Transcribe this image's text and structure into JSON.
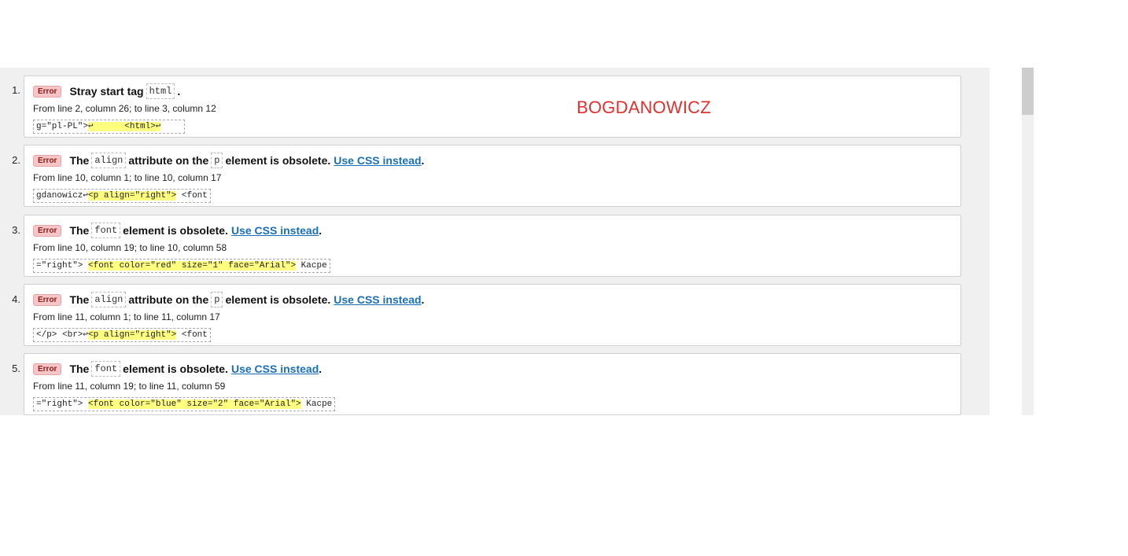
{
  "watermark": "BOGDANOWICZ",
  "messages": [
    {
      "num": "1.",
      "badge": "Error",
      "t1": "Stray start tag",
      "c1": "html",
      "t2": ".",
      "c2": "",
      "t3": "",
      "link": "",
      "end": "",
      "location": "From line 2, column 26; to line 3, column 12",
      "ext_pre": "g=\"pl-PL\">",
      "ext_hl": "↩      <html>↩",
      "ext_post": "    "
    },
    {
      "num": "2.",
      "badge": "Error",
      "t1": "The",
      "c1": "align",
      "t2": "attribute on the",
      "c2": "p",
      "t3": "element is obsolete.",
      "link": "Use CSS instead",
      "end": ".",
      "location": "From line 10, column 1; to line 10, column 17",
      "ext_pre": "gdanowicz↩",
      "ext_hl": "<p align=\"right\">",
      "ext_post": " <font"
    },
    {
      "num": "3.",
      "badge": "Error",
      "t1": "The",
      "c1": "font",
      "t2": "element is obsolete.",
      "c2": "",
      "t3": "",
      "link": "Use CSS instead",
      "end": ".",
      "location": "From line 10, column 19; to line 10, column 58",
      "ext_pre": "=\"right\"> ",
      "ext_hl": "<font color=\"red\" size=\"1\" face=\"Arial\">",
      "ext_post": " Kacpe"
    },
    {
      "num": "4.",
      "badge": "Error",
      "t1": "The",
      "c1": "align",
      "t2": "attribute on the",
      "c2": "p",
      "t3": "element is obsolete.",
      "link": "Use CSS instead",
      "end": ".",
      "location": "From line 11, column 1; to line 11, column 17",
      "ext_pre": "</p> <br>↩",
      "ext_hl": "<p align=\"right\">",
      "ext_post": " <font"
    },
    {
      "num": "5.",
      "badge": "Error",
      "t1": "The",
      "c1": "font",
      "t2": "element is obsolete.",
      "c2": "",
      "t3": "",
      "link": "Use CSS instead",
      "end": ".",
      "location": "From line 11, column 19; to line 11, column 59",
      "ext_pre": "=\"right\"> ",
      "ext_hl": "<font color=\"blue\" size=\"2\" face=\"Arial\">",
      "ext_post": " Kacpe"
    }
  ]
}
